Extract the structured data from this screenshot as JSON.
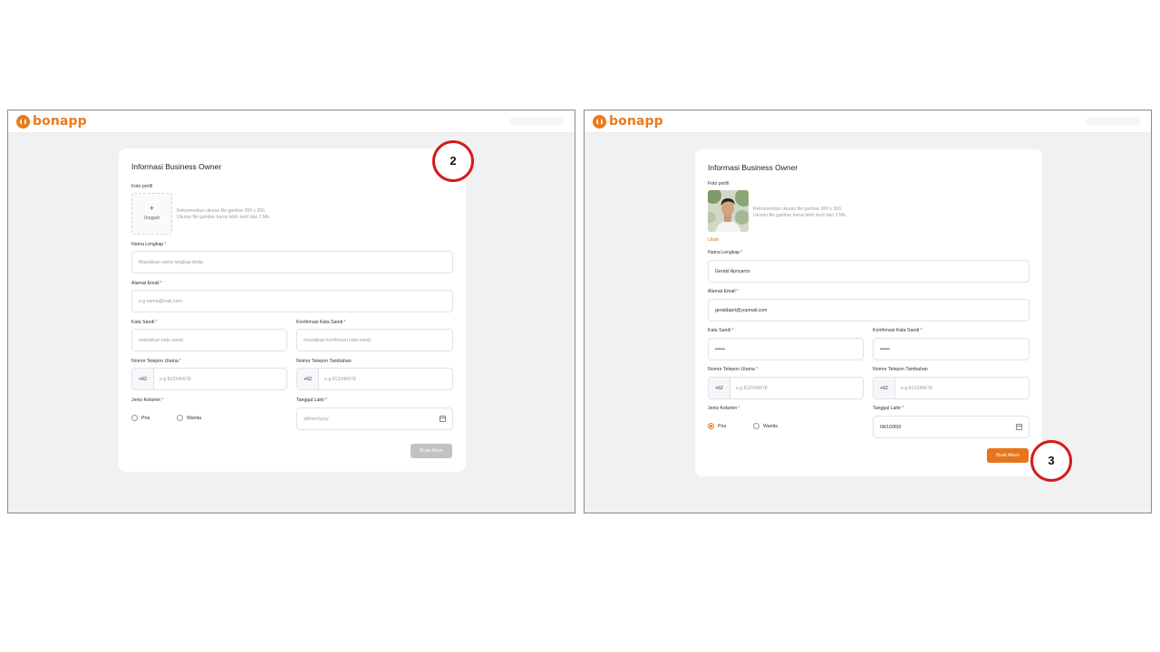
{
  "brand": {
    "name": "bonapp",
    "color": "#ea7a1e"
  },
  "steps": {
    "left": "2",
    "right": "3"
  },
  "form": {
    "title": "Informasi Business Owner",
    "photo_label": "Foto profil",
    "upload_plus": "+",
    "upload_label": "Unggah",
    "photo_hint_1": "Rekomendasi ukuran file gambar 300 x 300.",
    "photo_hint_2": "Ukuran file gambar harus lebih kecil dari 2 Mb.",
    "change_photo": "Ubah",
    "name_label": "Nama Lengkap",
    "name_placeholder": "Masukkan nama lengkap Anda",
    "email_label": "Alamat Email",
    "email_placeholder": "e.g nama@mail.com",
    "password_label": "Kata Sandi",
    "password_placeholder": "masukkan kata sandi",
    "confirm_label": "Konfirmasi Kata Sandi",
    "confirm_placeholder": "masukkan konfirmasi kata sandi",
    "phone_label": "Nomor Telepon Utama",
    "phone_alt_label": "Nomor Telepon Tambahan",
    "phone_prefix": "+62",
    "phone_placeholder": "e.g 812345678",
    "gender_label": "Jenis Kelamin",
    "gender_male": "Pria",
    "gender_female": "Wanita",
    "dob_label": "Tanggal Lahir",
    "dob_placeholder": "dd/mm/yyyy",
    "required_mark": "*",
    "submit_label": "Buat Akun"
  },
  "filled": {
    "name": "Gerald Apriyanto",
    "email": "geraldapri@yopmail.com",
    "password": "••••••",
    "confirm": "••••••",
    "dob": "04/10/999",
    "gender_selected": "Pria"
  },
  "icons": {
    "calendar": "calendar-icon",
    "avatar": "profile-photo"
  }
}
